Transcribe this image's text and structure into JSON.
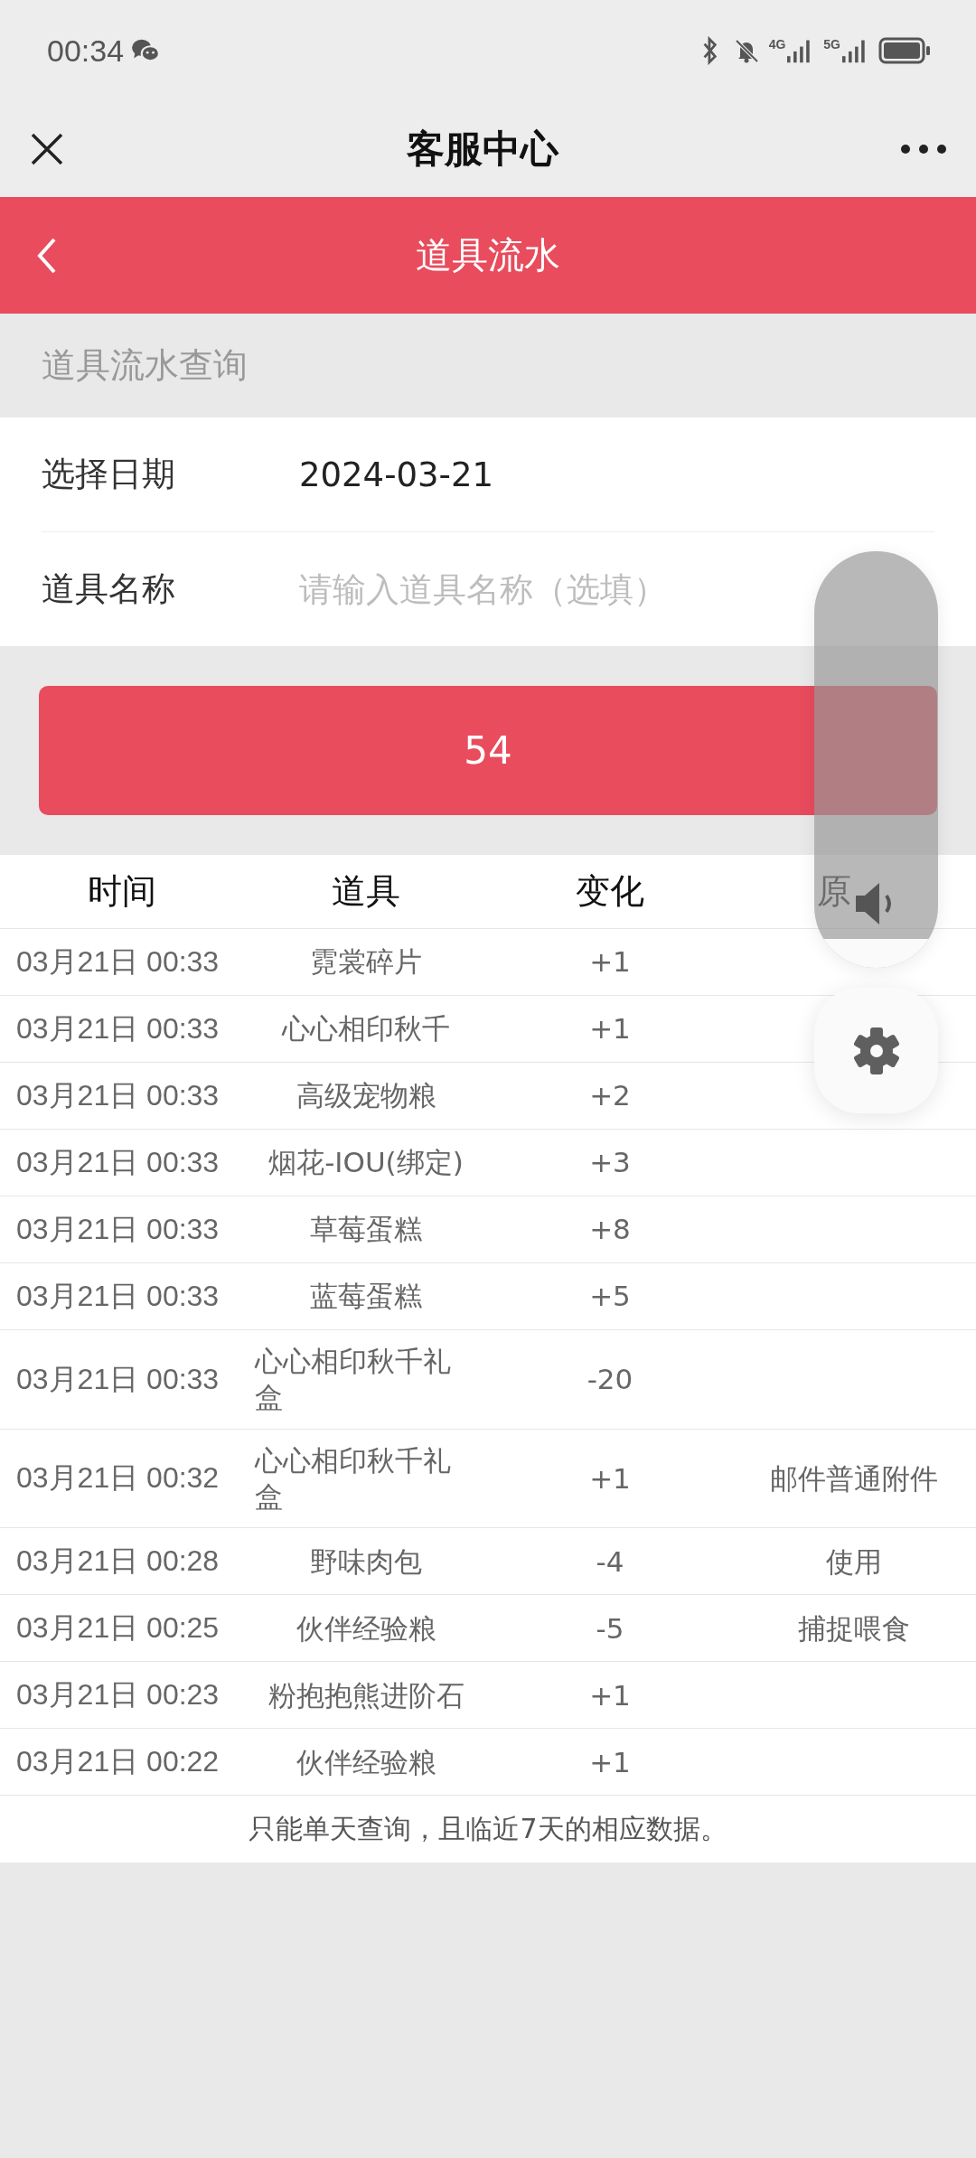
{
  "status_bar": {
    "time": "00:34",
    "network_1": "4G",
    "network_2": "5G"
  },
  "app_bar": {
    "title": "客服中心"
  },
  "header": {
    "title": "道具流水"
  },
  "section_title": "道具流水查询",
  "fields": [
    {
      "label": "选择日期",
      "value": "2024-03-21"
    },
    {
      "label": "道具名称",
      "placeholder": "请输入道具名称（选填）"
    }
  ],
  "query_button": "54",
  "table": {
    "columns": [
      "时间",
      "道具",
      "变化",
      "原"
    ],
    "rows": [
      {
        "cells": [
          "03月21日 00:33",
          "霓裳碎片",
          "+1"
        ]
      },
      {
        "cells": [
          "03月21日 00:33",
          "心心相印秋千",
          "+1"
        ]
      },
      {
        "cells": [
          "03月21日 00:33",
          "高级宠物粮",
          "+2"
        ]
      },
      {
        "cells": [
          "03月21日 00:33",
          "烟花-IOU(绑定)",
          "+3"
        ]
      },
      {
        "cells": [
          "03月21日 00:33",
          "草莓蛋糕",
          "+8"
        ]
      },
      {
        "cells": [
          "03月21日 00:33",
          "蓝莓蛋糕",
          "+5"
        ]
      },
      {
        "cells": [
          "03月21日 00:33",
          "心心相印秋千礼盒",
          "-20"
        ]
      },
      {
        "cells": [
          "03月21日 00:32",
          "心心相印秋千礼盒",
          "+1",
          "邮件普通附件"
        ]
      },
      {
        "cells": [
          "03月21日 00:28",
          "野味肉包",
          "-4",
          "使用"
        ]
      },
      {
        "cells": [
          "03月21日 00:25",
          "伙伴经验粮",
          "-5",
          "捕捉喂食"
        ]
      },
      {
        "cells": [
          "03月21日 00:23",
          "粉抱抱熊进阶石",
          "+1"
        ]
      },
      {
        "cells": [
          "03月21日 00:22",
          "伙伴经验粮",
          "+1"
        ]
      }
    ]
  },
  "footer_note": "只能单天查询，且临近7天的相应数据。",
  "volume_panel": {
    "level": 0.07
  }
}
